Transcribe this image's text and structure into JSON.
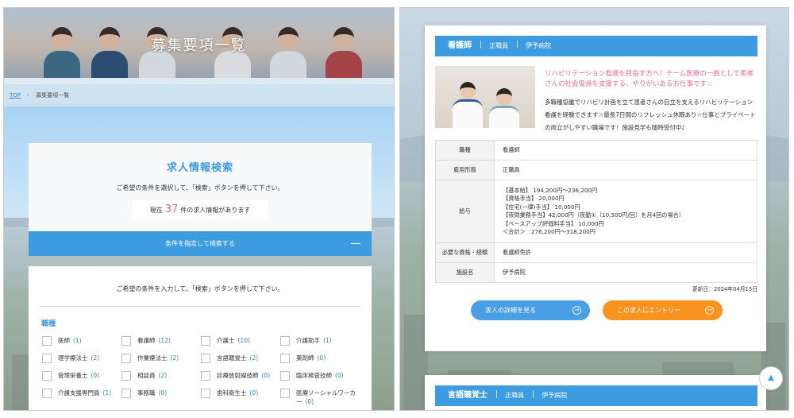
{
  "left": {
    "hero_title": "募集要項一覧",
    "breadcrumb": {
      "top": "TOP",
      "separator": "›",
      "current": "募集要項一覧"
    },
    "search": {
      "title": "求人情報検索",
      "description": "ご希望の条件を選択して、「検索」ボタンを押して下さい。",
      "count_prefix": "現在",
      "count": "37",
      "count_suffix": "件の求人情報があります"
    },
    "toggle_label": "条件を指定して検索する",
    "form": {
      "description": "ご希望の条件を入力して、「検索」ボタンを押して下さい。",
      "section_title": "職種",
      "options": [
        {
          "label": "医師",
          "count": "(1)"
        },
        {
          "label": "看護師",
          "count": "(12)"
        },
        {
          "label": "介護士",
          "count": "(10)"
        },
        {
          "label": "介護助手",
          "count": "(1)"
        },
        {
          "label": "理学療法士",
          "count": "(2)"
        },
        {
          "label": "作業療法士",
          "count": "(2)"
        },
        {
          "label": "言語聴覚士",
          "count": "(2)"
        },
        {
          "label": "薬剤師",
          "count": "(0)"
        },
        {
          "label": "管理栄養士",
          "count": "(0)"
        },
        {
          "label": "相談員",
          "count": "(2)"
        },
        {
          "label": "診療放射線技師",
          "count": "(0)"
        },
        {
          "label": "臨床検査技師",
          "count": "(0)"
        },
        {
          "label": "介護支援専門員",
          "count": "(1)"
        },
        {
          "label": "事務職",
          "count": "(0)"
        },
        {
          "label": "歯科衛生士",
          "count": "(0)"
        },
        {
          "label": "医療ソーシャルワーカー",
          "count": "(0)"
        }
      ]
    }
  },
  "right": {
    "job": {
      "title": "看護師",
      "employment": "正職員",
      "facility": "伊予病院",
      "catch": "リハビリテーション看護を目指す方へ！チーム医療の一員として患者さんの社会復帰を支援する、やりがいあるお仕事です☆",
      "intro": "多職種協働でリハビリ計画を立て患者さんの自立を支えるリハビリテーション看護を経験できます☆最長7日間のリフレッシュ休暇あり☆仕事とプライベートの両立がしやすい職場です！施設見学も随時受付中♪",
      "table": {
        "row1_label": "職種",
        "row1_value": "看護師",
        "row2_label": "雇用形態",
        "row2_value": "正職員",
        "row3_label": "給与",
        "salary_lines": [
          "【基本給】 194,200円〜236,200円",
          "【資格手当】 20,000円",
          "【住宅(一律)手当】 10,000円",
          "【夜間業務手当】42,000円（夜勤①（10,500円/回）を月4回の場合）",
          "【ベースアップ評価料手当】 10,000円",
          "＜合計＞　276,200円〜318,200円"
        ],
        "row4_label": "必要な資格・経験",
        "row4_value": "看護師免許",
        "row5_label": "施設名",
        "row5_value": "伊予病院"
      },
      "updated": "更新日：2024年04月15日",
      "detail_button": "求人の詳細を見る",
      "entry_button": "この求人にエントリー"
    },
    "job2": {
      "title": "言語聴覚士",
      "employment": "正職員",
      "facility": "伊予病院"
    },
    "pagetop_icon": "arrow-up-icon"
  },
  "colors": {
    "accent_blue": "#3d9be0",
    "entry_orange": "#f7931e",
    "catch_pink": "#e8709a",
    "count_pink": "#e8707f"
  }
}
